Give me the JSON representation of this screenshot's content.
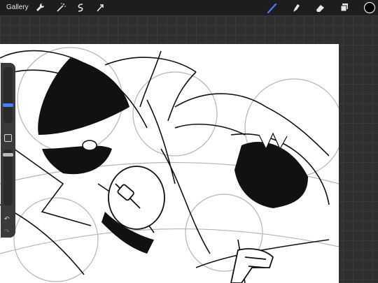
{
  "topbar": {
    "gallery_label": "Gallery",
    "left_tools": [
      "wrench-icon",
      "magic-wand-icon",
      "selection-icon",
      "transform-arrow-icon"
    ],
    "right_tools": [
      "brush-icon",
      "smudge-icon",
      "eraser-icon",
      "layers-icon"
    ],
    "current_color": "#000000",
    "active_tool_color": "#4e7df5"
  },
  "sidebar": {
    "brush_size": 0.62,
    "opacity": 0.75,
    "undo_icon": "↶",
    "redo_icon": "↷"
  },
  "canvas": {
    "background": "#ffffff"
  }
}
